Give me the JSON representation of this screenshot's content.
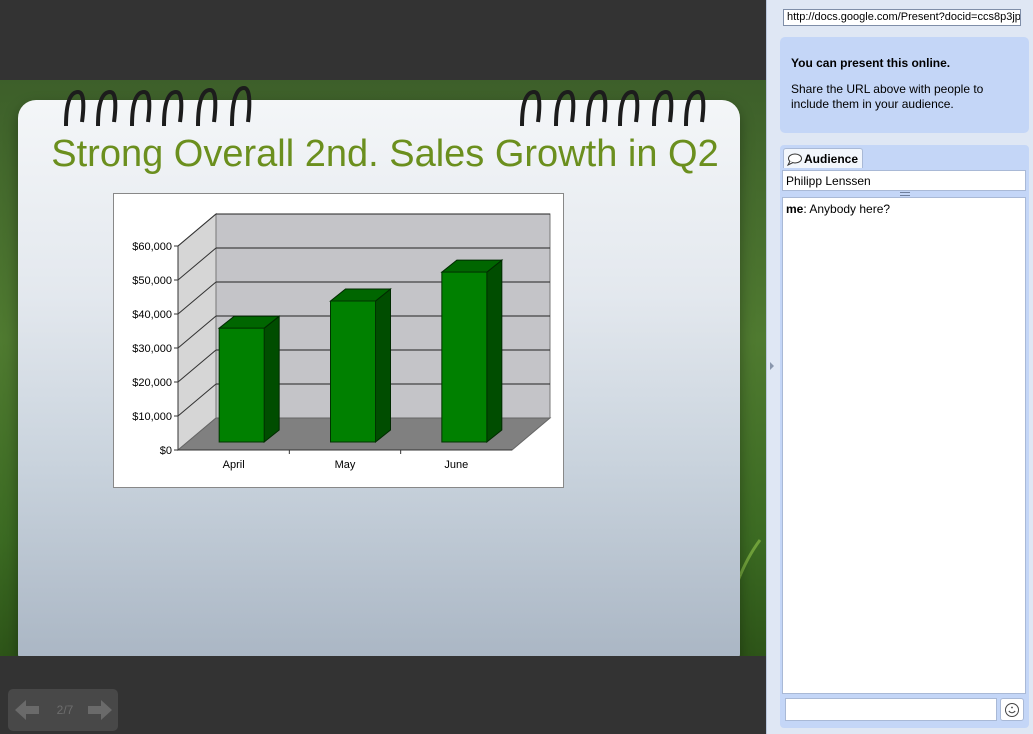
{
  "slide": {
    "title": "Strong Overall 2nd. Sales Growth in Q2"
  },
  "navigation": {
    "page_indicator": "2/7",
    "prev_icon": "left-arrow-icon",
    "next_icon": "right-arrow-icon"
  },
  "panel": {
    "url": "http://docs.google.com/Present?docid=ccs8p3jp",
    "info_title": "You can present this online.",
    "info_body": "Share the URL above with people to include them in your audience.",
    "audience_tab_label": "Audience",
    "audience_members": [
      "Philipp Lenssen"
    ],
    "chat": [
      {
        "sender": "me",
        "message": ": Anybody here?"
      }
    ]
  },
  "colors": {
    "bar_front": "#008000",
    "bar_side": "#004d00",
    "bar_top": "#006600",
    "title": "#6b8f1e",
    "panel_bg": "#dfe7f4",
    "info_bg": "#c4d6f7"
  },
  "chart_data": {
    "type": "bar",
    "categories": [
      "April",
      "May",
      "June"
    ],
    "values": [
      37000,
      45000,
      53500
    ],
    "yticks": [
      "$0",
      "$10,000",
      "$20,000",
      "$30,000",
      "$40,000",
      "$50,000",
      "$60,000"
    ],
    "ylim": [
      0,
      60000
    ],
    "grid": true,
    "three_d": true
  }
}
